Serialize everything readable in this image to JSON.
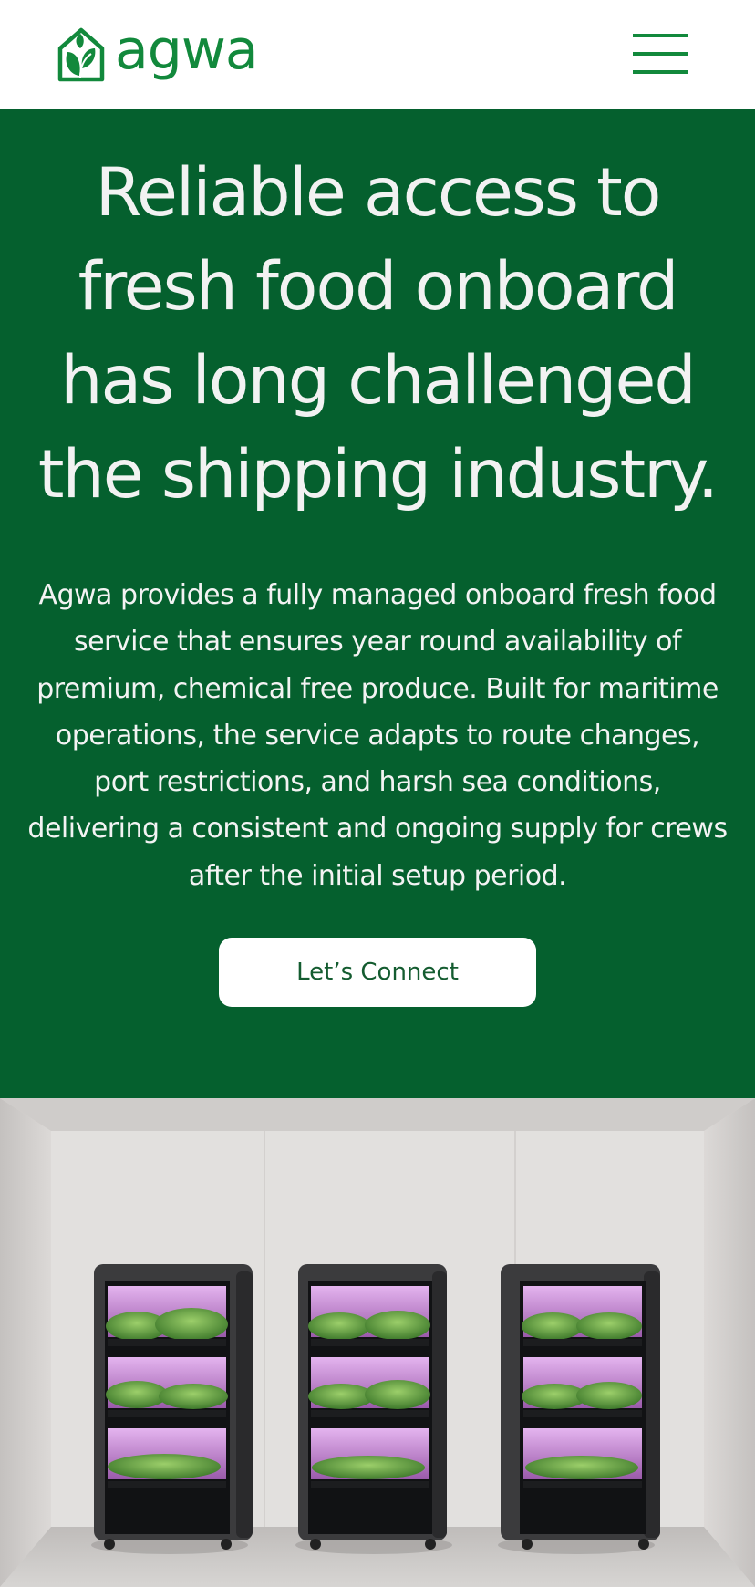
{
  "brand": {
    "name": "agwa",
    "logo_icon": "leaf-house-icon",
    "color": "#12893c"
  },
  "header": {
    "menu_icon": "hamburger-menu-icon"
  },
  "hero": {
    "background": "#05602e",
    "title": "Reliable access to fresh food onboard has long challenged the shipping industry.",
    "body": "Agwa provides a fully managed onboard fresh food service that ensures year round availability of premium, chemical free produce. Built for maritime operations, the service adapts to route changes, port restrictions, and harsh sea conditions, delivering a consistent and ongoing supply for crews after the initial setup period.",
    "cta_label": "Let’s Connect"
  },
  "photo": {
    "subject": "three-grow-cabinets-image",
    "grow_light_color": "#d39ee0"
  }
}
